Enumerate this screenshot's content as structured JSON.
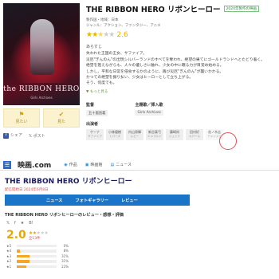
{
  "poster": {
    "title": "the RIBBON HERO",
    "subtitle": "Girls Archives"
  },
  "actions": [
    {
      "label": "見たい",
      "icon": "bookmark-icon"
    },
    {
      "label": "見た",
      "icon": "check-icon"
    }
  ],
  "share": {
    "facebook": "シェア",
    "twitter": "ポスト"
  },
  "header": {
    "title": "THE RIBBON HERO リボンヒーロー",
    "badge": "2024年製作の映画"
  },
  "meta": {
    "line1": "製作国・地域：日本",
    "line2": "ジャンル：アクション、ファンタジー、アニメ"
  },
  "rating": {
    "score": "2.6",
    "stars_on": "★★",
    "stars_half": "★",
    "stars_off": "★★"
  },
  "synopsis": {
    "heading": "あらすじ",
    "text": "失われた王国の王女、サファイア。\n災厄\"ぎんのん\"の出現シルバーランドのすべてを奪われ、絶望の果てにゴールドランドへとたどり着く。\n絶望を抱えながらも、人々の優しさに触れ、少女の中に眠る力が目覚め始める。\nしかし、平和な日常を侵食するかのように、再び災厄\"ぎんのん\"が襲いかかる。\nかつての絶望を振り払い、少女はヒーローとして立ち上がる。\nそう、何度でも。",
    "more": "もっと見る"
  },
  "staff": [
    {
      "role": "監督",
      "name": "五十嵐直義"
    },
    {
      "role": "主題歌／挿入歌",
      "name": "Girls Archives"
    }
  ],
  "cast": {
    "heading": "出演者",
    "people": [
      {
        "name": "ケーナ",
        "role": "サファイア"
      },
      {
        "name": "小林優樹",
        "role": "トパーズ"
      },
      {
        "name": "内山昂輝",
        "role": "ルビー"
      },
      {
        "name": "新谷真弓",
        "role": "エメラルド"
      },
      {
        "name": "藤崎尚",
        "role": "ジェイド"
      },
      {
        "name": "田村好",
        "role": "オパール"
      },
      {
        "name": "花ノ木吉",
        "role": "アメジスト"
      }
    ]
  },
  "site": {
    "logo": "映画.com",
    "nav": [
      {
        "label": "作品",
        "icon": "film-icon"
      },
      {
        "label": "映画館",
        "icon": "theater-icon"
      },
      {
        "label": "ニュース",
        "icon": "news-icon"
      }
    ],
    "movie_title": "THE RIBBON HERO リボンヒーロー",
    "date": "配信開始日 2024年6月8日",
    "tabs": [
      "ニュース",
      "フォトギャラリー",
      "レビュー"
    ],
    "review_heading": "THE RIBBON HERO リボンヒーローのレビュー・感想・評価",
    "score": "2.0",
    "review_count": "全13件",
    "distribution": [
      {
        "label": "★5",
        "pct": 0
      },
      {
        "label": "★4",
        "pct": 8
      },
      {
        "label": "★3",
        "pct": 31
      },
      {
        "label": "★2",
        "pct": 31
      },
      {
        "label": "★1",
        "pct": 23
      }
    ]
  },
  "colors": {
    "accent": "#1a74c8",
    "star": "#e8b400",
    "highlight": "#e05050"
  }
}
